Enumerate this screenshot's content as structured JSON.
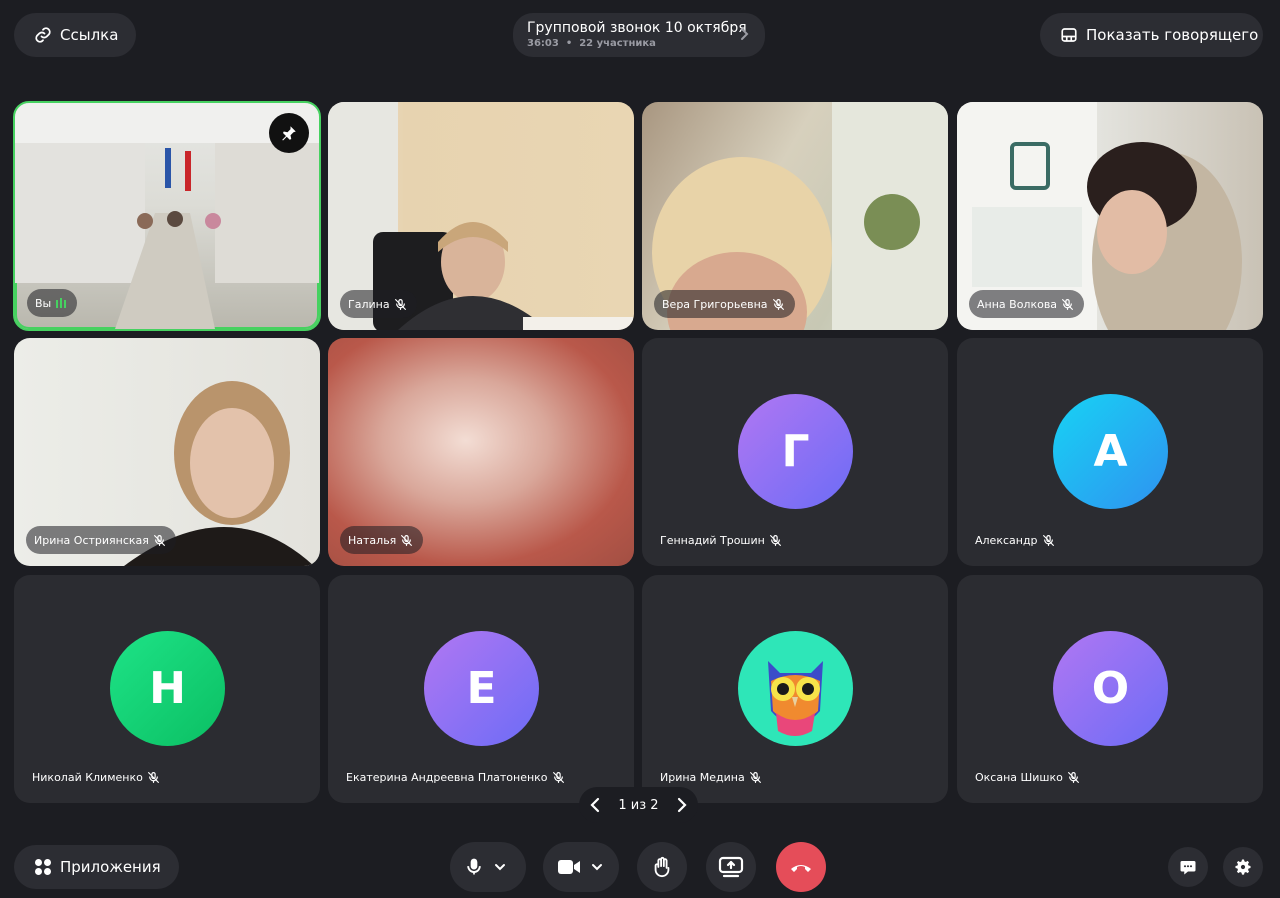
{
  "header": {
    "link_label": "Ссылка",
    "call_title": "Групповой звонок 10 октября",
    "call_duration": "36:03",
    "call_participants": "22 участника",
    "call_meta_separator": "•",
    "speaker_label": "Показать говорящего"
  },
  "tiles": [
    {
      "name": "Вы",
      "type": "video",
      "mic": "speaking",
      "pinned": true
    },
    {
      "name": "Галина",
      "type": "video",
      "mic": "muted"
    },
    {
      "name": "Вера Григорьевна",
      "type": "video",
      "mic": "muted"
    },
    {
      "name": "Анна Волкова",
      "type": "video",
      "mic": "muted"
    },
    {
      "name": "Ирина Остриянская",
      "type": "video",
      "mic": "muted"
    },
    {
      "name": "Наталья",
      "type": "video",
      "mic": "muted"
    },
    {
      "name": "Геннадий Трошин",
      "type": "avatar",
      "initial": "Г",
      "mic": "muted"
    },
    {
      "name": "Александр",
      "type": "avatar",
      "initial": "А",
      "mic": "muted"
    },
    {
      "name": "Николай Клименко",
      "type": "avatar",
      "initial": "Н",
      "mic": "muted"
    },
    {
      "name": "Екатерина Андреевна Платоненко",
      "type": "avatar",
      "initial": "Е",
      "mic": "muted"
    },
    {
      "name": "Ирина Медина",
      "type": "avatar",
      "avatar_icon": "owl-avatar-icon",
      "mic": "muted"
    },
    {
      "name": "Оксана Шишко",
      "type": "avatar",
      "initial": "О",
      "mic": "muted"
    }
  ],
  "pager": {
    "label": "1 из 2"
  },
  "footer": {
    "apps_label": "Приложения"
  },
  "colors": {
    "background": "#1c1d22",
    "tile": "#2b2c31",
    "active_border": "#46d160",
    "hangup": "#e54d59",
    "avatar_purple": "#8d6bf0",
    "avatar_blue": "#1ec4f5",
    "avatar_green": "#0fd07a"
  }
}
